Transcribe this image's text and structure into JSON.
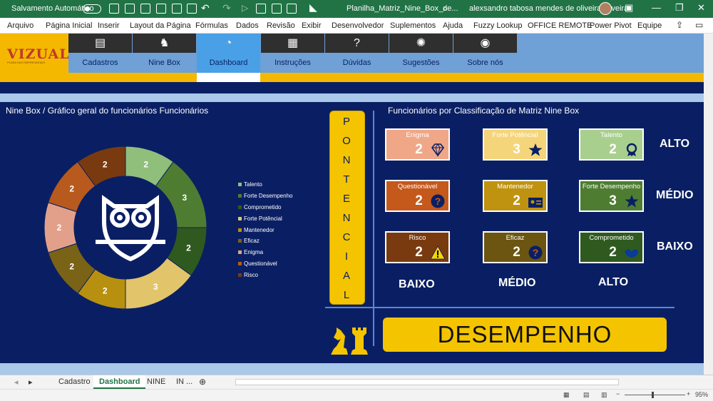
{
  "titlebar": {
    "autosave": "Salvamento Automático",
    "filename": "Planilha_Matriz_Nine_Box_de...",
    "user": "alexsandro tabosa mendes de oliveira oliveira"
  },
  "menu": [
    "Arquivo",
    "Página Inicial",
    "Inserir",
    "Layout da Página",
    "Fórmulas",
    "Dados",
    "Revisão",
    "Exibir",
    "Desenvolvedor",
    "Suplementos",
    "Ajuda",
    "Fuzzy Lookup",
    "OFFICE REMOTE",
    "Power Pivot",
    "Equipe"
  ],
  "logo": {
    "name": "VIZUAL",
    "sub": "PLANILHAS EMPRESARIAIS"
  },
  "nav": [
    {
      "label": "Cadastros",
      "icon": "printer-icon",
      "glyph": "▤"
    },
    {
      "label": "Nine Box",
      "icon": "chess-icon",
      "glyph": "♞"
    },
    {
      "label": "Dashboard",
      "icon": "pie-chart-icon",
      "glyph": "◔"
    },
    {
      "label": "Instruções",
      "icon": "teacher-icon",
      "glyph": "▦"
    },
    {
      "label": "Dúvidas",
      "icon": "question-users-icon",
      "glyph": "?"
    },
    {
      "label": "Sugestões",
      "icon": "lightbulb-icon",
      "glyph": "✺"
    },
    {
      "label": "Sobre nós",
      "icon": "owl-icon",
      "glyph": "◉"
    }
  ],
  "chart_title": "Nine Box / Gráfico geral do funcionários Funcionários",
  "matrix_title": "Funcionários por Classificação de Matriz Nine Box",
  "chart_data": {
    "type": "pie",
    "donut": true,
    "categories": [
      "Talento",
      "Forte Desempenho",
      "Comprometido",
      "Forte Potêncial",
      "Mantenedor",
      "Eficaz",
      "Enigma",
      "Questionável",
      "Risco"
    ],
    "values": [
      2,
      3,
      2,
      3,
      2,
      2,
      2,
      2,
      2
    ],
    "colors": [
      "#8fbf7a",
      "#4e7d32",
      "#2f5a1f",
      "#e2c46a",
      "#b8900f",
      "#7a6316",
      "#e2a08a",
      "#b85a1e",
      "#7a3a10"
    ]
  },
  "legend_colors": [
    "#8fbf7a",
    "#4e7d32",
    "#2f5a1f",
    "#e2c46a",
    "#b8900f",
    "#7a6316",
    "#e2a08a",
    "#b85a1e",
    "#7a3a10"
  ],
  "potencial": [
    "P",
    "O",
    "N",
    "T",
    "E",
    "N",
    "C",
    "I",
    "A",
    "L"
  ],
  "boxes": [
    {
      "title": "Enigma",
      "value": "2",
      "bg": "#f0a787",
      "fg": "#fff",
      "icon": "diamond-icon"
    },
    {
      "title": "Forte Potêncial",
      "value": "3",
      "bg": "#f5d57a",
      "fg": "#fff",
      "icon": "star-icon"
    },
    {
      "title": "Talento",
      "value": "2",
      "bg": "#a9cf8e",
      "fg": "#fff",
      "icon": "award-icon"
    },
    {
      "title": "Questionável",
      "value": "2",
      "bg": "#c5581b",
      "fg": "#fff",
      "icon": "question-icon"
    },
    {
      "title": "Mantenedor",
      "value": "2",
      "bg": "#bf930f",
      "fg": "#fff",
      "icon": "id-card-icon"
    },
    {
      "title": "Forte Desempenho",
      "value": "3",
      "bg": "#4e7d32",
      "fg": "#fff",
      "icon": "star-icon"
    },
    {
      "title": "Risco",
      "value": "2",
      "bg": "#7a3a10",
      "fg": "#fff",
      "icon": "warning-icon"
    },
    {
      "title": "Eficaz",
      "value": "2",
      "bg": "#6b5510",
      "fg": "#fff",
      "icon": "question-icon"
    },
    {
      "title": "Comprometido",
      "value": "2",
      "bg": "#2f5a1f",
      "fg": "#fff",
      "icon": "handshake-icon"
    }
  ],
  "levels_y": [
    "ALTO",
    "MÉDIO",
    "BAIXO"
  ],
  "levels_x": [
    "BAIXO",
    "MÉDIO",
    "ALTO"
  ],
  "desempenho": "DESEMPENHO",
  "sheets": [
    "Cadastro",
    "Dashboard",
    "NINE",
    "IN ..."
  ],
  "zoom": "95%"
}
